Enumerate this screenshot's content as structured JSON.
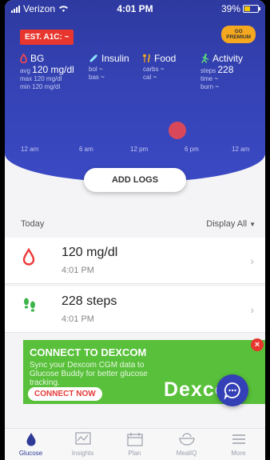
{
  "status_bar": {
    "carrier": "Verizon",
    "time": "4:01 PM",
    "battery": "39%"
  },
  "header": {
    "est_a1c": "EST. A1C: ~",
    "premium_line1": "GO",
    "premium_line2": "PREMIUM"
  },
  "metrics": {
    "bg": {
      "title": "BG",
      "avg_label": "avg",
      "avg_value": "120 mg/dl",
      "max": "max 120 mg/dl",
      "min": "min 120 mg/dl"
    },
    "insulin": {
      "title": "Insulin",
      "bol_label": "bol",
      "bol_value": "~",
      "bas_label": "bas",
      "bas_value": "~"
    },
    "food": {
      "title": "Food",
      "carbs_label": "carbs",
      "carbs_value": "~",
      "cal_label": "cal",
      "cal_value": "~"
    },
    "activity": {
      "title": "Activity",
      "steps_label": "steps",
      "steps_value": "228",
      "time_label": "time",
      "time_value": "~",
      "burn_label": "burn",
      "burn_value": "~"
    }
  },
  "timeline": {
    "ticks": [
      "12 am",
      "6 am",
      "12 pm",
      "6 pm",
      "12 am"
    ]
  },
  "add_logs": "ADD LOGS",
  "list": {
    "section_label": "Today",
    "filter_label": "Display All",
    "entries": [
      {
        "value": "120 mg/dl",
        "time": "4:01 PM",
        "icon": "blood-drop-icon"
      },
      {
        "value": "228 steps",
        "time": "4:01 PM",
        "icon": "footsteps-icon"
      }
    ]
  },
  "promo": {
    "title": "CONNECT TO DEXCOM",
    "subtitle": "Sync your Dexcom CGM data to Glucose Buddy for better glucose tracking.",
    "cta": "CONNECT NOW",
    "logo_text": "Dexcom",
    "close": "×"
  },
  "tabs": [
    {
      "label": "Glucose",
      "active": true
    },
    {
      "label": "Insights",
      "active": false
    },
    {
      "label": "Plan",
      "active": false
    },
    {
      "label": "MealIQ",
      "active": false
    },
    {
      "label": "More",
      "active": false
    }
  ],
  "colors": {
    "primary": "#3644b8",
    "accent_red": "#e8362e",
    "promo_green": "#58c03a",
    "premium_orange": "#f5a81f"
  }
}
